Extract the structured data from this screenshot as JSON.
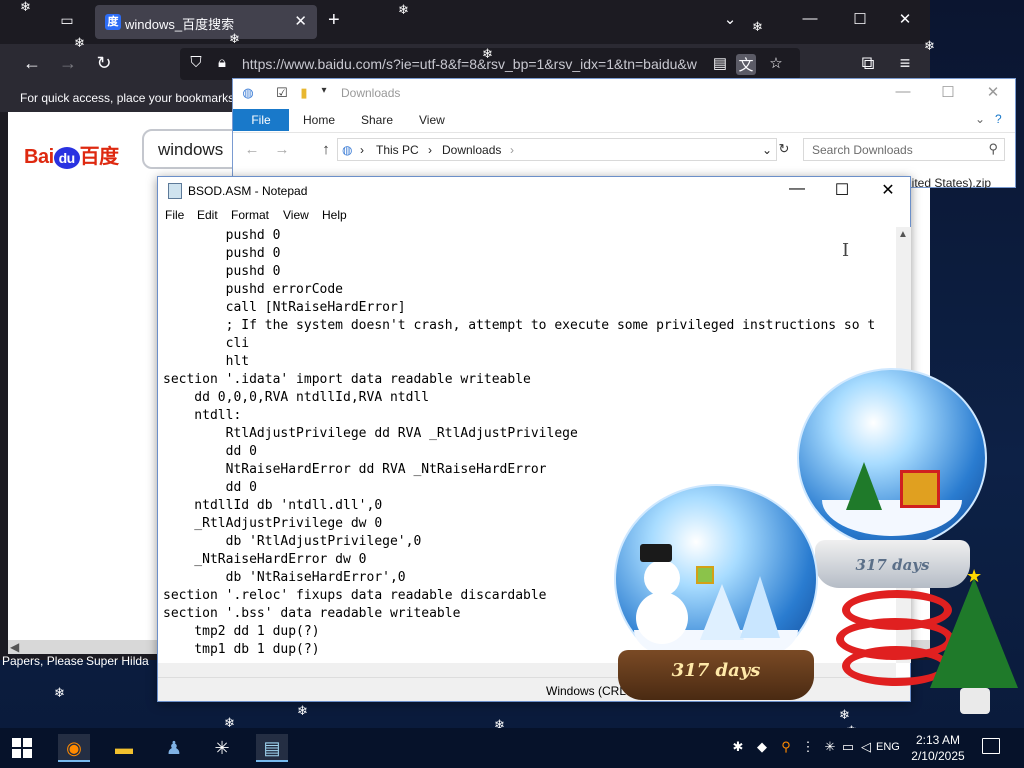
{
  "browser": {
    "tab_title": "windows_百度搜索",
    "tab_close": "✕",
    "new_tab": "+",
    "url": "https://www.baidu.com/s?ie=utf-8&f=8&rsv_bp=1&rsv_idx=1&tn=baidu&w",
    "bookmarks_hint": "For quick access, place your bookmarks",
    "baidu_logo_text": "Bai",
    "baidu_logo_du": "du",
    "baidu_logo_cn": "百度",
    "search_query": "windows",
    "bottom_bookmarks": [
      "Papers, Please",
      "Super Hilda"
    ]
  },
  "explorer": {
    "title": "Downloads",
    "ribbon_tabs": [
      "File",
      "Home",
      "Share",
      "View"
    ],
    "breadcrumb": [
      "This PC",
      "Downloads"
    ],
    "search_placeholder": "Search Downloads",
    "file_fragment": "nited States).zip"
  },
  "notepad": {
    "title": "BSOD.ASM - Notepad",
    "menus": [
      "File",
      "Edit",
      "Format",
      "View",
      "Help"
    ],
    "lines": [
      "        pushd 0",
      "        pushd 0",
      "        pushd 0",
      "        pushd errorCode",
      "        call [NtRaiseHardError]",
      "        ; If the system doesn't crash, attempt to execute some privileged instructions so t",
      "        cli",
      "        hlt",
      "section '.idata' import data readable writeable",
      "    dd 0,0,0,RVA ntdllId,RVA ntdll",
      "    ntdll:",
      "        RtlAdjustPrivilege dd RVA _RtlAdjustPrivilege",
      "        dd 0",
      "        NtRaiseHardError dd RVA _NtRaiseHardError",
      "        dd 0",
      "    ntdllId db 'ntdll.dll',0",
      "    _RtlAdjustPrivilege dw 0",
      "        db 'RtlAdjustPrivilege',0",
      "    _NtRaiseHardError dw 0",
      "        db 'NtRaiseHardError',0",
      "section '.reloc' fixups data readable discardable",
      "section '.bss' data readable writeable",
      "    tmp2 dd 1 dup(?)",
      "    tmp1 db 1 dup(?)"
    ],
    "status_encoding": "Windows (CRLF)"
  },
  "globes": {
    "front_label": "317 days",
    "back_label": "317 days"
  },
  "taskbar": {
    "language": "ENG",
    "time": "2:13 AM",
    "date": "2/10/2025"
  },
  "colors": {
    "explorer_file_tab": "#1979ca",
    "baidu_red": "#de2910",
    "baidu_blue": "#2932e1",
    "firefox_dark": "#1c1b22"
  }
}
